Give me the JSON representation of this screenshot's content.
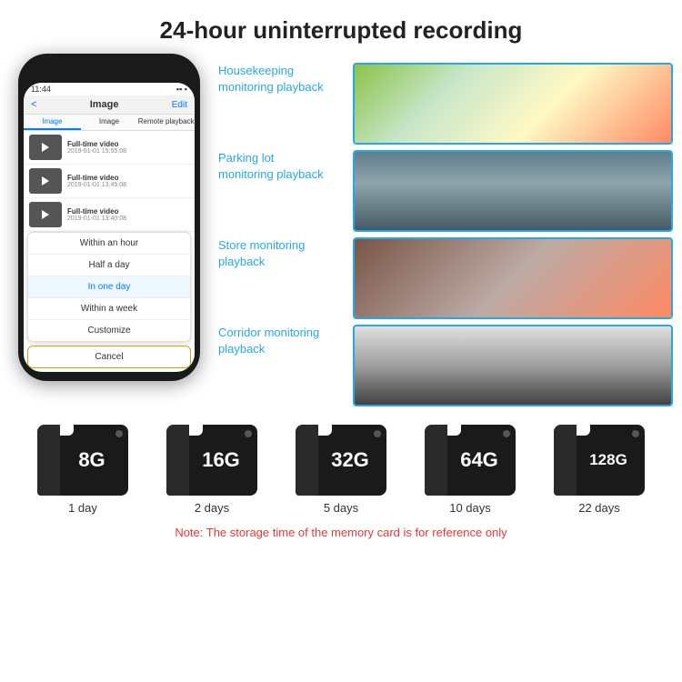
{
  "header": {
    "title": "24-hour uninterrupted recording"
  },
  "phone": {
    "time": "11:44",
    "screen_title": "Image",
    "back_label": "<",
    "edit_label": "Edit",
    "tabs": [
      "Image",
      "Image",
      "Remote playback"
    ],
    "list_items": [
      {
        "title": "Full-time video",
        "date": "2019-01-01 15:55:08"
      },
      {
        "title": "Full-time video",
        "date": "2019-01-01 13:45:08"
      },
      {
        "title": "Full-time video",
        "date": "2019-01-01 13:40:08"
      }
    ],
    "dropdown_items": [
      {
        "label": "Within an hour",
        "highlighted": false
      },
      {
        "label": "Half a day",
        "highlighted": false
      },
      {
        "label": "In one day",
        "highlighted": true
      },
      {
        "label": "Within a week",
        "highlighted": false
      },
      {
        "label": "Customize",
        "highlighted": false
      }
    ],
    "cancel_label": "Cancel"
  },
  "monitoring": [
    {
      "label": "Housekeeping monitoring playback",
      "img_type": "housekeeping"
    },
    {
      "label": "Parking lot monitoring playback",
      "img_type": "parking"
    },
    {
      "label": "Store monitoring playback",
      "img_type": "store"
    },
    {
      "label": "Corridor monitoring playback",
      "img_type": "corridor"
    }
  ],
  "sd_cards": [
    {
      "size": "8G",
      "days": "1 day"
    },
    {
      "size": "16G",
      "days": "2 days"
    },
    {
      "size": "32G",
      "days": "5 days"
    },
    {
      "size": "64G",
      "days": "10 days"
    },
    {
      "size": "128G",
      "days": "22 days"
    }
  ],
  "note": "Note: The storage time of the memory card is for reference only",
  "colors": {
    "accent": "#29a8e0",
    "note_red": "#e53935"
  }
}
